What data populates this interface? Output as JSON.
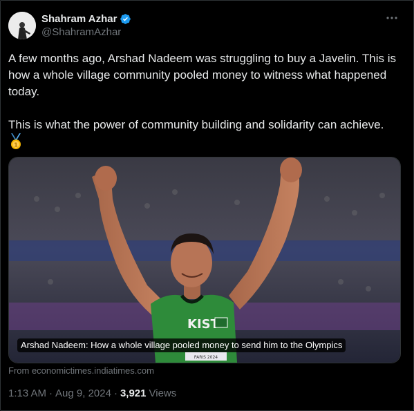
{
  "author": {
    "display_name": "Shahram Azhar",
    "handle": "@ShahramAzhar",
    "verified": true,
    "verified_color": "#1d9bf0"
  },
  "more_icon": "more-horizontal-icon",
  "tweet": {
    "text": "A few months ago, Arshad Nadeem was struggling to buy a Javelin. This is how a whole village community pooled money to witness what happened today.\n\nThis is what the power of community building and solidarity can achieve.",
    "emoji_icon": "gold-medal-icon"
  },
  "media": {
    "caption": "Arshad Nadeem: How a whole village pooled money to send him to the Olympics",
    "jersey_text": "KIST",
    "bib_text": "PARIS 2024"
  },
  "link_source": "From economictimes.indiatimes.com",
  "meta": {
    "time": "1:13 AM",
    "separator": "·",
    "date": "Aug 9, 2024",
    "separator2": "·",
    "views_count": "3,921",
    "views_label": "Views"
  },
  "colors": {
    "background": "#000000",
    "text": "#e7e9ea",
    "secondary_text": "#71767b",
    "border": "#2f3336",
    "jersey_green": "#2e8b3a"
  }
}
